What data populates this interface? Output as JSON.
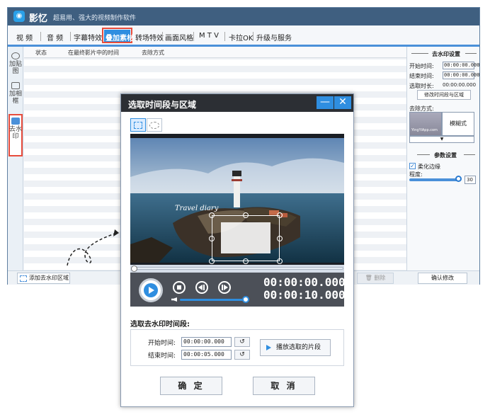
{
  "app": {
    "name": "影忆",
    "slogan": "超易用、强大的视频制作软件"
  },
  "menu": {
    "items": [
      "视 频",
      "音 频",
      "字幕特效",
      "叠加素材",
      "转场特效",
      "画面风格",
      "M T V",
      "卡拉OK",
      "升级与服务"
    ]
  },
  "sidebar": {
    "tabs": [
      "加贴图",
      "加相框",
      "去水印"
    ]
  },
  "list": {
    "columns": [
      "状态",
      "在最终影片中的时间",
      "去除方式"
    ]
  },
  "bottombar": {
    "add_label": "添加去水印区域",
    "delete_label": "删除",
    "confirm_label": "确认修改"
  },
  "right_panel": {
    "section_title": "去水印设置",
    "start_label": "开始时间:",
    "start_value": "00:00:00.000",
    "end_label": "结束时间:",
    "end_value": "00:00:00.000",
    "duration_label": "选取时长:",
    "duration_value": "00:00:00.000",
    "edit_button": "修改时间段与区域",
    "method_label": "去除方式:",
    "thumb_caption": "YingYiApp.com",
    "method_value": "模糊式",
    "dropdown_arrow": "▼",
    "params_title": "参数设置",
    "soften_label": "柔化边缘",
    "soften_checked": true,
    "degree_label": "程度:",
    "degree_value": "30",
    "degree_level": 30
  },
  "dialog": {
    "title": "选取时间段与区域",
    "minimize": "—",
    "close": "✕",
    "overlay_text": "Travel diary",
    "time_current": "00:00:00.000",
    "time_total": "00:00:10.000",
    "progress_fraction": 0,
    "volume_fraction": 1.0,
    "segment_title": "选取去水印时间段:",
    "start_label": "开始时间:",
    "start_value": "00:00:00.000",
    "end_label": "结束时间:",
    "end_value": "00:00:05.000",
    "play_segment": "播放选取的片段",
    "ok": "确 定",
    "cancel": "取 消"
  }
}
